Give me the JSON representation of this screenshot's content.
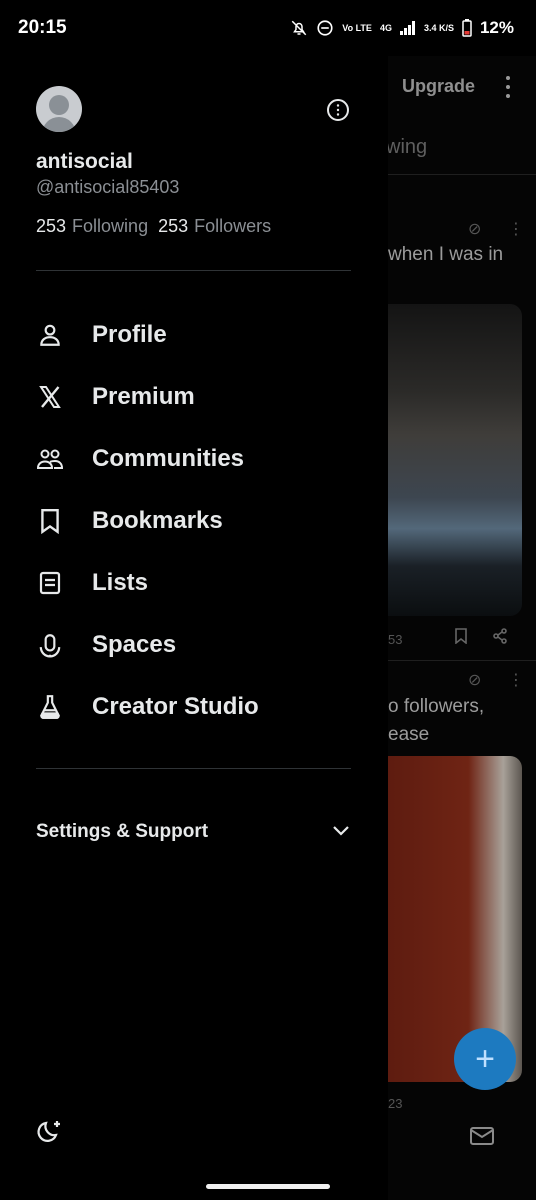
{
  "status_bar": {
    "time": "20:15",
    "network_top": "Vo LTE",
    "network_gen": "4G",
    "speed": "3.4 K/S",
    "battery": "12%"
  },
  "background_feed": {
    "upgrade_label": "Upgrade",
    "tab_partial": "wing",
    "post1_text": "when I was in",
    "post1_count": "53",
    "post2_text_line1": "o followers,",
    "post2_text_line2": "ease",
    "post2_count": "23",
    "fab_symbol": "+",
    "accent": "#1d7ac0"
  },
  "profile": {
    "name": "antisocial",
    "handle": "@antisocial85403",
    "following_count": "253",
    "following_label": "Following",
    "followers_count": "253",
    "followers_label": "Followers"
  },
  "menu": {
    "items": [
      {
        "label": "Profile",
        "icon": "person-icon"
      },
      {
        "label": "Premium",
        "icon": "x-logo-icon"
      },
      {
        "label": "Communities",
        "icon": "people-icon"
      },
      {
        "label": "Bookmarks",
        "icon": "bookmark-icon"
      },
      {
        "label": "Lists",
        "icon": "list-icon"
      },
      {
        "label": "Spaces",
        "icon": "microphone-icon"
      },
      {
        "label": "Creator Studio",
        "icon": "flask-icon"
      }
    ]
  },
  "settings": {
    "label": "Settings & Support"
  },
  "colors": {
    "background": "#000000",
    "text_primary": "#e7e9ea",
    "text_secondary": "#8b8f94",
    "divider": "#2f3336"
  }
}
